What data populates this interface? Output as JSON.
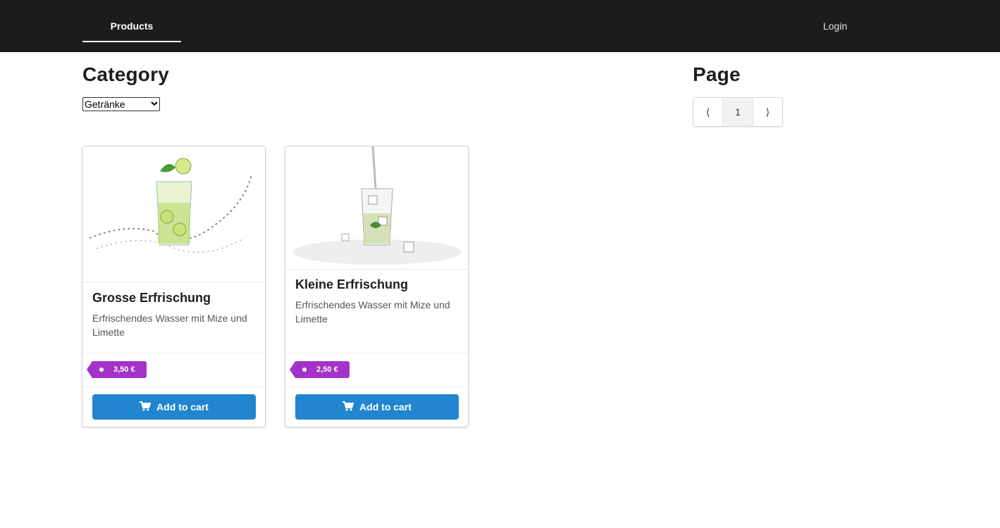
{
  "nav": {
    "products_label": "Products",
    "login_label": "Login"
  },
  "category": {
    "title": "Category",
    "selected": "Getränke"
  },
  "pagination": {
    "title": "Page",
    "prev": "⟨",
    "current": "1",
    "next": "⟩"
  },
  "products": [
    {
      "name": "Grosse Erfrischung",
      "description": "Erfrischendes Wasser mit Mize und Limette",
      "price": "3,50 €",
      "cart_label": "Add to cart"
    },
    {
      "name": "Kleine Erfrischung",
      "description": "Erfrischendes Wasser mit Mize und Limette",
      "price": "2,50 €",
      "cart_label": "Add to cart"
    }
  ],
  "colors": {
    "navbar": "#1b1c1d",
    "price_tag": "#a333c8",
    "cart_button": "#2185d0"
  }
}
